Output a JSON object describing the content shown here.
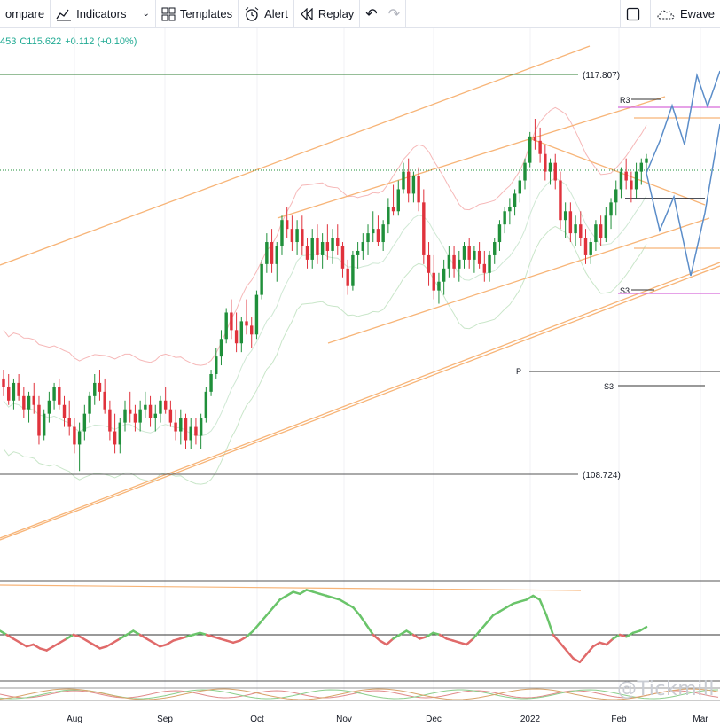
{
  "toolbar": {
    "compare_label": "ompare",
    "indicators_label": "Indicators",
    "templates_label": "Templates",
    "alert_label": "Alert",
    "replay_label": "Replay",
    "right_label": "Ewave"
  },
  "quote": {
    "prefix": "453",
    "close": "C115.622",
    "change": "+0.112 (+0.10%)"
  },
  "watermark": "@Tickmill",
  "colors": {
    "up": "#1f8f3a",
    "down": "#e0323c",
    "channel": "#f7b477",
    "wave": "#5b8dc9",
    "pivot_magenta": "#d66bd9",
    "rsi_up": "#6ac46a",
    "rsi_down": "#e06a6a"
  },
  "chart_data": {
    "type": "candlestick",
    "x_ticks": [
      "Aug",
      "Sep",
      "Oct",
      "Nov",
      "Dec",
      "2022",
      "Feb",
      "Mar"
    ],
    "price_levels": [
      {
        "label": "(117.807)",
        "value": 117.807
      },
      {
        "label": "(108.724)",
        "value": 108.724
      }
    ],
    "pivot_labels": [
      "R3",
      "S3",
      "P",
      "S3"
    ],
    "series": [
      {
        "name": "price",
        "candles": [
          [
            110.9,
            111.1,
            110.5,
            110.7
          ],
          [
            110.7,
            111.0,
            110.3,
            110.4
          ],
          [
            110.4,
            110.9,
            110.2,
            110.8
          ],
          [
            110.8,
            111.0,
            110.4,
            110.5
          ],
          [
            110.5,
            110.7,
            110.0,
            110.2
          ],
          [
            110.2,
            110.6,
            109.9,
            110.5
          ],
          [
            110.5,
            110.8,
            110.1,
            110.3
          ],
          [
            110.3,
            110.5,
            109.4,
            109.6
          ],
          [
            109.6,
            110.2,
            109.5,
            110.1
          ],
          [
            110.1,
            110.6,
            109.9,
            110.4
          ],
          [
            110.4,
            110.8,
            110.2,
            110.7
          ],
          [
            110.7,
            110.9,
            110.2,
            110.3
          ],
          [
            110.3,
            110.5,
            109.8,
            110.0
          ],
          [
            110.0,
            110.4,
            109.6,
            109.8
          ],
          [
            109.8,
            110.0,
            109.2,
            109.4
          ],
          [
            109.4,
            109.9,
            108.8,
            109.7
          ],
          [
            109.7,
            110.3,
            109.5,
            110.1
          ],
          [
            110.1,
            110.6,
            109.9,
            110.5
          ],
          [
            110.5,
            111.0,
            110.3,
            110.8
          ],
          [
            110.8,
            111.1,
            110.4,
            110.6
          ],
          [
            110.6,
            110.9,
            110.1,
            110.2
          ],
          [
            110.2,
            110.4,
            109.5,
            109.7
          ],
          [
            109.7,
            110.1,
            109.2,
            109.4
          ],
          [
            109.4,
            110.0,
            109.2,
            109.9
          ],
          [
            109.9,
            110.4,
            109.7,
            110.2
          ],
          [
            110.2,
            110.6,
            109.9,
            110.1
          ],
          [
            110.1,
            110.3,
            109.7,
            109.9
          ],
          [
            109.9,
            110.4,
            109.7,
            110.2
          ],
          [
            110.2,
            110.6,
            110.0,
            110.3
          ],
          [
            110.3,
            110.5,
            109.8,
            110.0
          ],
          [
            110.0,
            110.3,
            109.7,
            110.1
          ],
          [
            110.1,
            110.5,
            109.9,
            110.4
          ],
          [
            110.4,
            110.7,
            110.1,
            110.2
          ],
          [
            110.2,
            110.4,
            109.8,
            109.9
          ],
          [
            109.9,
            110.2,
            109.5,
            109.7
          ],
          [
            109.7,
            110.2,
            109.4,
            110.0
          ],
          [
            110.0,
            110.1,
            109.3,
            109.5
          ],
          [
            109.5,
            110.0,
            109.3,
            109.8
          ],
          [
            109.8,
            110.0,
            109.4,
            109.6
          ],
          [
            109.6,
            110.1,
            109.3,
            110.0
          ],
          [
            110.0,
            110.7,
            109.9,
            110.6
          ],
          [
            110.6,
            111.1,
            110.5,
            111.0
          ],
          [
            111.0,
            111.6,
            110.9,
            111.4
          ],
          [
            111.4,
            112.0,
            111.2,
            111.8
          ],
          [
            111.8,
            112.5,
            111.7,
            112.4
          ],
          [
            112.4,
            112.7,
            111.8,
            112.0
          ],
          [
            112.0,
            112.4,
            111.5,
            111.7
          ],
          [
            111.7,
            112.3,
            111.5,
            112.2
          ],
          [
            112.2,
            112.7,
            111.9,
            112.1
          ],
          [
            112.1,
            112.3,
            111.6,
            111.9
          ],
          [
            111.9,
            112.9,
            111.8,
            112.8
          ],
          [
            112.8,
            113.6,
            112.7,
            113.5
          ],
          [
            113.5,
            114.2,
            113.3,
            114.0
          ],
          [
            114.0,
            114.3,
            113.3,
            113.5
          ],
          [
            113.5,
            114.0,
            113.1,
            113.9
          ],
          [
            113.9,
            114.6,
            113.7,
            114.5
          ],
          [
            114.5,
            114.8,
            114.1,
            114.3
          ],
          [
            114.3,
            114.6,
            113.8,
            114.0
          ],
          [
            114.0,
            114.5,
            113.7,
            114.3
          ],
          [
            114.3,
            114.6,
            113.7,
            113.9
          ],
          [
            113.9,
            114.1,
            113.4,
            113.6
          ],
          [
            113.6,
            114.3,
            113.4,
            114.1
          ],
          [
            114.1,
            114.4,
            113.5,
            113.7
          ],
          [
            113.7,
            114.2,
            113.4,
            114.0
          ],
          [
            114.0,
            114.4,
            113.6,
            113.8
          ],
          [
            113.8,
            114.3,
            113.5,
            114.1
          ],
          [
            114.1,
            114.4,
            113.7,
            113.9
          ],
          [
            113.9,
            114.0,
            113.2,
            113.4
          ],
          [
            113.4,
            113.6,
            112.8,
            113.0
          ],
          [
            113.0,
            113.8,
            112.9,
            113.7
          ],
          [
            113.7,
            114.0,
            113.4,
            113.8
          ],
          [
            113.8,
            114.2,
            113.6,
            114.0
          ],
          [
            114.0,
            114.4,
            113.7,
            114.2
          ],
          [
            114.2,
            114.7,
            114.0,
            114.3
          ],
          [
            114.3,
            114.6,
            113.9,
            114.0
          ],
          [
            114.0,
            114.5,
            113.8,
            114.4
          ],
          [
            114.4,
            115.0,
            114.2,
            114.8
          ],
          [
            114.8,
            115.3,
            114.6,
            114.7
          ],
          [
            114.7,
            115.4,
            114.6,
            115.2
          ],
          [
            115.2,
            115.8,
            115.1,
            115.6
          ],
          [
            115.6,
            115.9,
            114.9,
            115.1
          ],
          [
            115.1,
            115.6,
            114.9,
            115.5
          ],
          [
            115.5,
            115.7,
            114.7,
            114.9
          ],
          [
            114.9,
            115.2,
            113.5,
            113.7
          ],
          [
            113.7,
            114.0,
            113.0,
            113.3
          ],
          [
            113.3,
            113.7,
            112.7,
            112.9
          ],
          [
            112.9,
            113.3,
            112.6,
            113.1
          ],
          [
            113.1,
            113.6,
            112.8,
            113.4
          ],
          [
            113.4,
            113.9,
            113.2,
            113.7
          ],
          [
            113.7,
            113.9,
            113.2,
            113.4
          ],
          [
            113.4,
            113.8,
            113.1,
            113.6
          ],
          [
            113.6,
            114.0,
            113.4,
            113.9
          ],
          [
            113.9,
            114.1,
            113.4,
            113.6
          ],
          [
            113.6,
            113.9,
            113.3,
            113.8
          ],
          [
            113.8,
            114.0,
            113.4,
            113.5
          ],
          [
            113.5,
            113.8,
            113.1,
            113.3
          ],
          [
            113.3,
            113.8,
            113.1,
            113.7
          ],
          [
            113.7,
            114.1,
            113.5,
            114.0
          ],
          [
            114.0,
            114.5,
            113.8,
            114.4
          ],
          [
            114.4,
            114.8,
            114.2,
            114.7
          ],
          [
            114.7,
            115.0,
            114.4,
            114.8
          ],
          [
            114.8,
            115.2,
            114.6,
            115.1
          ],
          [
            115.1,
            115.5,
            114.9,
            115.4
          ],
          [
            115.4,
            115.9,
            115.2,
            115.8
          ],
          [
            115.8,
            116.5,
            115.7,
            116.4
          ],
          [
            116.4,
            116.8,
            116.1,
            116.3
          ],
          [
            116.3,
            116.6,
            115.8,
            116.0
          ],
          [
            116.0,
            116.2,
            115.4,
            115.6
          ],
          [
            115.6,
            115.9,
            115.3,
            115.8
          ],
          [
            115.8,
            116.0,
            115.2,
            115.4
          ],
          [
            115.4,
            115.6,
            114.3,
            114.5
          ],
          [
            114.5,
            114.9,
            114.1,
            114.7
          ],
          [
            114.7,
            114.9,
            114.0,
            114.2
          ],
          [
            114.2,
            114.6,
            113.9,
            114.4
          ],
          [
            114.4,
            114.7,
            113.9,
            114.1
          ],
          [
            114.1,
            114.3,
            113.5,
            113.7
          ],
          [
            113.7,
            114.1,
            113.5,
            114.0
          ],
          [
            114.0,
            114.5,
            113.8,
            114.4
          ],
          [
            114.4,
            114.6,
            113.9,
            114.1
          ],
          [
            114.1,
            114.8,
            114.0,
            114.6
          ],
          [
            114.6,
            115.0,
            114.3,
            114.9
          ],
          [
            114.9,
            115.4,
            114.6,
            115.2
          ],
          [
            115.2,
            115.7,
            115.0,
            115.6
          ],
          [
            115.6,
            115.9,
            115.2,
            115.4
          ],
          [
            115.4,
            115.6,
            114.9,
            115.2
          ],
          [
            115.2,
            115.8,
            115.0,
            115.6
          ],
          [
            115.6,
            115.9,
            115.3,
            115.8
          ],
          [
            115.8,
            116.0,
            115.5,
            115.9
          ]
        ]
      },
      {
        "name": "rsi",
        "values": [
          52,
          50,
          48,
          46,
          44,
          45,
          43,
          42,
          44,
          46,
          48,
          50,
          49,
          47,
          45,
          43,
          44,
          46,
          48,
          50,
          52,
          50,
          48,
          46,
          44,
          45,
          47,
          48,
          49,
          50,
          51,
          50,
          49,
          48,
          47,
          46,
          47,
          49,
          52,
          56,
          60,
          64,
          68,
          70,
          72,
          71,
          73,
          72,
          71,
          70,
          69,
          68,
          66,
          64,
          60,
          55,
          50,
          47,
          45,
          48,
          50,
          52,
          50,
          48,
          49,
          51,
          50,
          48,
          47,
          46,
          45,
          48,
          52,
          56,
          60,
          62,
          64,
          66,
          67,
          68,
          70,
          68,
          60,
          50,
          46,
          42,
          38,
          36,
          40,
          44,
          46,
          45,
          48,
          50,
          49,
          51,
          52,
          54
        ]
      }
    ]
  }
}
